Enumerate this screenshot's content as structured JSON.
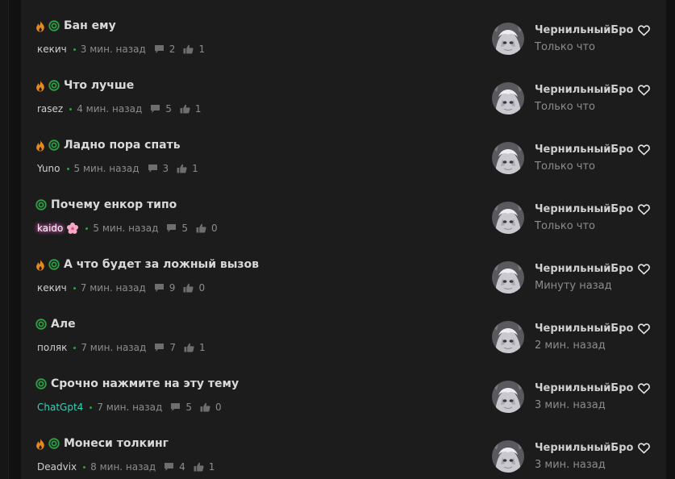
{
  "threads": [
    {
      "title": "Бан ему",
      "hot": true,
      "author": "кекич",
      "author_style": "normal",
      "time": "3 мин. назад",
      "comments": "2",
      "likes": "1",
      "last_user": "ЧернильныйБро",
      "last_time": "Только что"
    },
    {
      "title": "Что лучше",
      "hot": true,
      "author": "rasez",
      "author_style": "normal",
      "time": "4 мин. назад",
      "comments": "5",
      "likes": "1",
      "last_user": "ЧернильныйБро",
      "last_time": "Только что"
    },
    {
      "title": "Ладно пора спать",
      "hot": true,
      "author": "Yuno",
      "author_style": "normal",
      "time": "5 мин. назад",
      "comments": "3",
      "likes": "1",
      "last_user": "ЧернильныйБро",
      "last_time": "Только что"
    },
    {
      "title": "Почему енкор типо",
      "hot": false,
      "author": "kaido",
      "author_style": "kaido",
      "time": "5 мин. назад",
      "comments": "5",
      "likes": "0",
      "last_user": "ЧернильныйБро",
      "last_time": "Только что"
    },
    {
      "title": "А что будет за ложный вызов",
      "hot": true,
      "author": "кекич",
      "author_style": "normal",
      "time": "7 мин. назад",
      "comments": "9",
      "likes": "0",
      "last_user": "ЧернильныйБро",
      "last_time": "Минуту назад"
    },
    {
      "title": "Але",
      "hot": false,
      "author": "поляк",
      "author_style": "normal",
      "time": "7 мин. назад",
      "comments": "7",
      "likes": "1",
      "last_user": "ЧернильныйБро",
      "last_time": "2 мин. назад"
    },
    {
      "title": "Срочно нажмите на эту тему",
      "hot": false,
      "author": "ChatGpt4",
      "author_style": "cgpt",
      "time": "7 мин. назад",
      "comments": "5",
      "likes": "0",
      "last_user": "ЧернильныйБро",
      "last_time": "3 мин. назад"
    },
    {
      "title": "Монеси толкинг",
      "hot": true,
      "author": "Deadvix",
      "author_style": "normal",
      "time": "8 мин. назад",
      "comments": "4",
      "likes": "1",
      "last_user": "ЧернильныйБро",
      "last_time": "3 мин. назад"
    }
  ],
  "icons": {
    "hot": "flame-icon",
    "status": "ring-icon",
    "comments": "comment-icon",
    "likes": "thumbs-up-icon",
    "favorite": "heart-icon",
    "author_badge": "sakura-flower-icon"
  },
  "colors": {
    "background": "#1c1c1c",
    "title": "#d9d9d9",
    "muted": "#8c8c8c",
    "accent_green": "#2ea043",
    "flame": "#e8891c",
    "kaido_glow": "#ff59c8",
    "chatgpt": "#3ad1b0"
  }
}
